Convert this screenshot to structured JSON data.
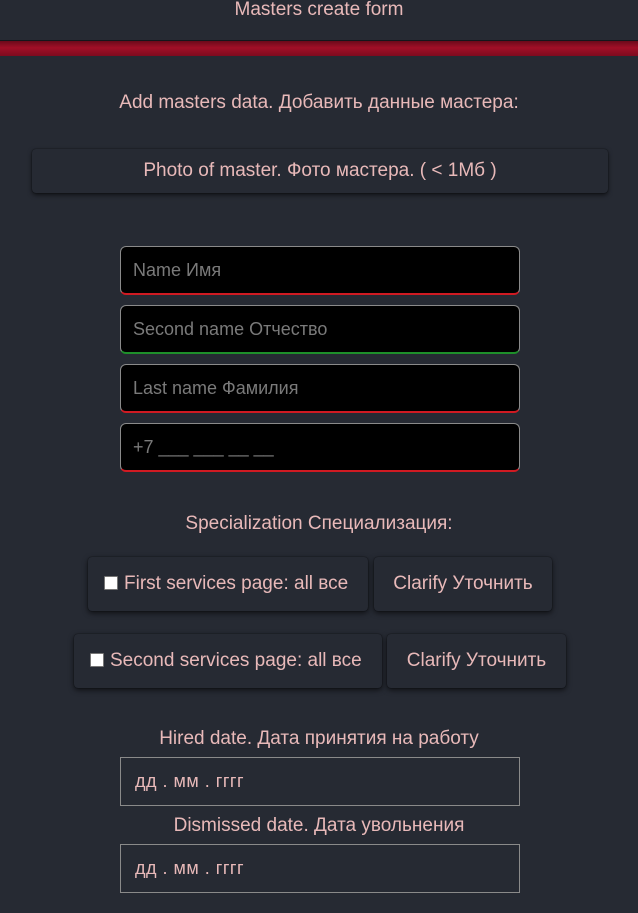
{
  "header": {
    "title": "Masters create form"
  },
  "intro": {
    "text": "Add masters data. Добавить данные мастера:"
  },
  "photo": {
    "label": "Photo of master. Фото мастера. ( < 1Мб )"
  },
  "fields": {
    "first_name_placeholder": "Name Имя",
    "second_name_placeholder": "Second name Отчество",
    "last_name_placeholder": "Last name Фамилия",
    "phone_placeholder": "+7 ___ ___ __ __"
  },
  "specialization": {
    "label": "Specialization Специализация:",
    "pages": [
      {
        "label": "First services page: all все",
        "clarify": "Clarify Уточнить"
      },
      {
        "label": "Second services page: all все",
        "clarify": "Clarify Уточнить"
      }
    ]
  },
  "dates": {
    "hired_label": "Hired date. Дата принятия на работу",
    "hired_value": "дд . мм . гггг",
    "dismissed_label": "Dismissed date. Дата увольнения",
    "dismissed_value": "дд . мм . гггг"
  },
  "colors": {
    "background": "#262a33",
    "accent_red": "#a10f27",
    "text": "#e8b9b9",
    "invalid_underline": "#d01a22",
    "valid_underline": "#1e8f2a"
  }
}
